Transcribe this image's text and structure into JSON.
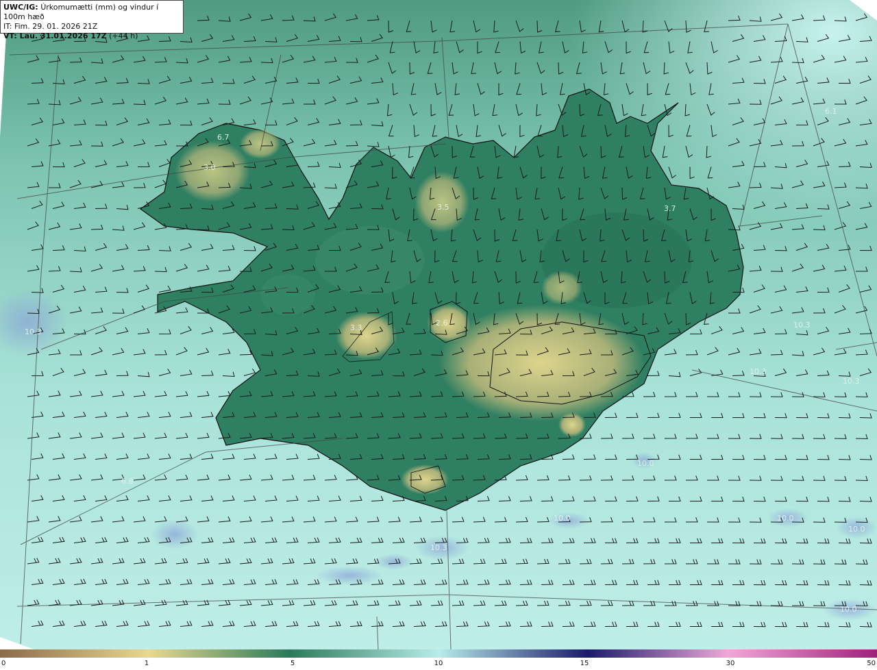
{
  "header": {
    "model": "UWC/IG:",
    "description": "Úrkomumætti (mm) og vindur í 100m hæð",
    "init_time": "IT: Fim. 29. 01. 2026 21Z",
    "valid_prefix": "VT: Lau. 31.01.2026 17Z",
    "valid_offset": "(+44 h)"
  },
  "map_labels": [
    {
      "text": "6.7"
    },
    {
      "text": "3.0"
    },
    {
      "text": "3.5"
    },
    {
      "text": "3.7"
    },
    {
      "text": "6.1"
    },
    {
      "text": "2.6"
    },
    {
      "text": "3.3"
    },
    {
      "text": "10.3"
    },
    {
      "text": "10.3"
    },
    {
      "text": "6.8"
    },
    {
      "text": "10.0"
    },
    {
      "text": "10.0"
    },
    {
      "text": "10.0"
    },
    {
      "text": "10.3"
    },
    {
      "text": "10.3"
    },
    {
      "text": "10.3"
    },
    {
      "text": "10.0"
    },
    {
      "text": "10.0"
    }
  ],
  "colorbar": {
    "labels": [
      "0",
      "1",
      "5",
      "10",
      "15",
      "30",
      "50"
    ],
    "colors": [
      "#8c6a4a",
      "#e8d890",
      "#2a7a5a",
      "#b8ecea",
      "#1a1a6a",
      "#f0a8d8",
      "#a0207a"
    ]
  },
  "colors": {
    "sea": "#a8e0d8",
    "land_low": "#2f8062",
    "land_high": "#d6d08a",
    "coast": "#111111",
    "barb": "#1a1a1a"
  }
}
